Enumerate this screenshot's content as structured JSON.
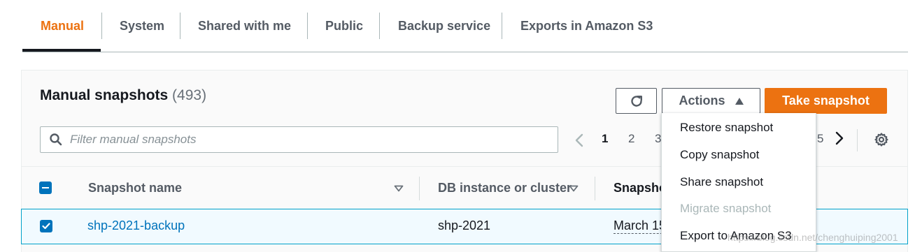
{
  "tabs": [
    {
      "label": "Manual"
    },
    {
      "label": "System"
    },
    {
      "label": "Shared with me"
    },
    {
      "label": "Public"
    },
    {
      "label": "Backup service"
    },
    {
      "label": "Exports in Amazon S3"
    }
  ],
  "panel": {
    "title": "Manual snapshots",
    "count": "(493)",
    "actions_label": "Actions",
    "take_snapshot_label": "Take snapshot",
    "refresh_icon": "refresh-icon"
  },
  "search": {
    "placeholder": "Filter manual snapshots",
    "value": ""
  },
  "pagination": {
    "pages": [
      "1",
      "2",
      "3"
    ],
    "last_page_partial": "5",
    "current_page": "1"
  },
  "table": {
    "columns": [
      "Snapshot name",
      "DB instance or cluster",
      "Snapshot"
    ],
    "rows": [
      {
        "name": "shp-2021-backup",
        "instance": "shp-2021",
        "time": "March 15"
      }
    ]
  },
  "actions_menu": {
    "items": [
      {
        "label": "Restore snapshot",
        "disabled": false
      },
      {
        "label": "Copy snapshot",
        "disabled": false
      },
      {
        "label": "Share snapshot",
        "disabled": false
      },
      {
        "label": "Migrate snapshot",
        "disabled": true
      },
      {
        "label": "Export to Amazon S3",
        "disabled": false
      }
    ]
  },
  "watermark": "https://blog.csdn.net/chenghuiping2001",
  "colors": {
    "accent": "#ec7211",
    "link": "#0073bb",
    "selected_row_bg": "#f1faff",
    "selected_row_border": "#00a1c9"
  }
}
